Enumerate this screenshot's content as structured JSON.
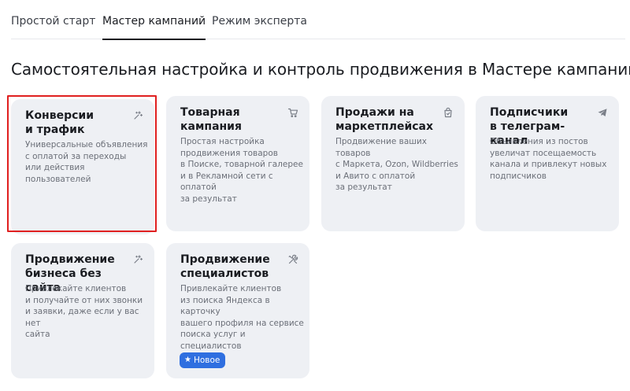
{
  "tabs": [
    {
      "label": "Простой старт",
      "active": false
    },
    {
      "label": "Мастер кампаний",
      "active": true
    },
    {
      "label": "Режим эксперта",
      "active": false
    }
  ],
  "heading": "Самостоятельная настройка и контроль продвижения в Мастере кампаний",
  "cards": [
    {
      "title": "Конверсии\nи трафик",
      "description": "Универсальные объявления\nс оплатой за переходы\nили действия пользователей",
      "icon": "sparkle-icon",
      "selected": true
    },
    {
      "title": "Товарная\nкампания",
      "description": "Простая настройка\nпродвижения товаров\nв Поиске, товарной галерее\nи в Рекламной сети с оплатой\nза результат",
      "icon": "cart-icon"
    },
    {
      "title": "Продажи на\nмаркетплейсах",
      "description": "Продвижение ваших товаров\nс Маркета, Ozon, Wildberries\nи Авито с оплатой\nза результат",
      "icon": "shopping-bag-icon"
    },
    {
      "title": "Подписчики\nв телеграм-канал",
      "description": "Объявления из постов\nувеличат посещаемость\nканала и привлекут новых\nподписчиков",
      "icon": "telegram-icon"
    },
    {
      "title": "Продвижение\nбизнеса без сайта",
      "description": "Привлекайте клиентов\nи получайте от них звонки\nи заявки, даже если у вас нет\nсайта",
      "icon": "sparkle-icon"
    },
    {
      "title": "Продвижение\nспециалистов",
      "description": "Привлекайте клиентов\nиз поиска Яндекса в карточку\nвашего профиля на сервисе\nпоиска услуг и специалистов",
      "icon": "tools-icon",
      "badge": "Новое"
    }
  ],
  "colors": {
    "card_bg": "#eef0f4",
    "selection": "#e02020",
    "badge_bg": "#2f6fe0"
  }
}
